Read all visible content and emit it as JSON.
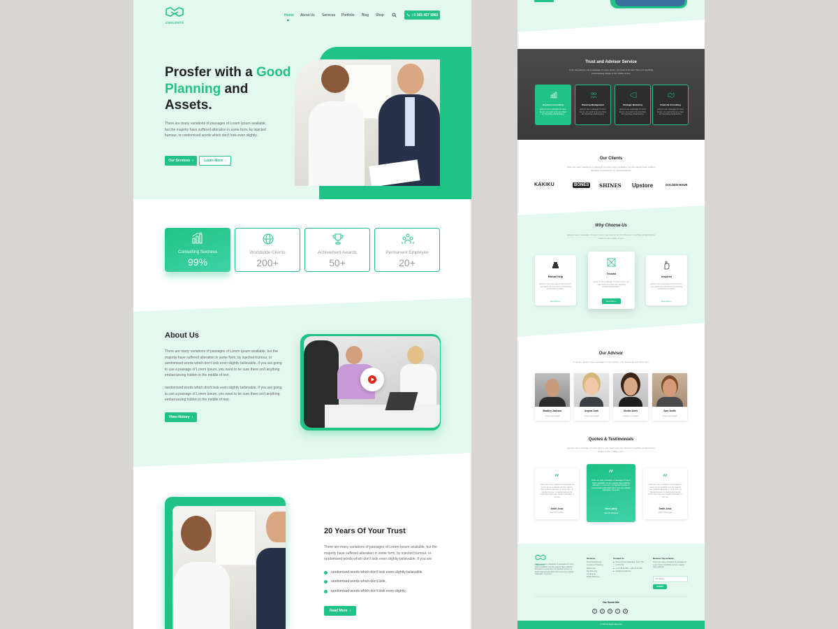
{
  "brand": {
    "name": "CNSLTNTS",
    "accent": "#21c288",
    "hero_bg": "#e3f8ef"
  },
  "nav": {
    "items": [
      "Home",
      "About Us",
      "Services",
      "Portfolio",
      "Blog",
      "Shop"
    ],
    "active": "Home",
    "phone": "+1 265 457 5963"
  },
  "hero": {
    "title_1": "Prosfer with a",
    "title_accent_1": "Good",
    "title_accent_2": "Planning",
    "title_2": "and",
    "title_3": "Assets.",
    "text": "There are many variations of passages of Lorem Ipsum available, but the majority have suffered alteration in some form, by injected humour, or randomised words which don't look even slightly.",
    "btn_services": "Our Services",
    "btn_learn": "Learn More"
  },
  "stats": [
    {
      "label": "Consulting Success",
      "value": "99%",
      "icon": "chart-icon",
      "active": true
    },
    {
      "label": "Worldwide Clients",
      "value": "200+",
      "icon": "globe-icon",
      "active": false
    },
    {
      "label": "Achivement Awards",
      "value": "50+",
      "icon": "trophy-icon",
      "active": false
    },
    {
      "label": "Permanent Employee",
      "value": "20+",
      "icon": "team-icon",
      "active": false
    }
  ],
  "about": {
    "title": "About Us",
    "p1": "There are many variations of passages of Lorem Ipsum available, but the majority have suffered alteration in some form, by injected humour, or randomised words which don't look even slightly believable. If you are going to use a passage of Lorem Ipsum, you need to be sure there isn't anything embarrassing hidden in the middle of text.",
    "p2": "randomised words which don't look even slightly believable. If you are going to use a passage of Lorem Ipsum, you need to be sure there isn't anything embarrassing hidden in the middle of text.",
    "btn": "View History"
  },
  "trust": {
    "title": "20 Years Of Your Trust",
    "text": "There are many variations of passages of Lorem Ipsum available, but the majority have suffered alteration in some form, by injected humour, or randomised words which don't look even slightly believable. If you are",
    "checks": [
      "randomised words which don't look even slightly believable.",
      "randomised words which don't look.",
      "randomised words which don't look even slightly."
    ],
    "btn": "Read More"
  },
  "service": {
    "title": "Trust and Advisor Service",
    "sub": "If you are going to use a passage of Lorem Ipsum, you need to be sure there isn't anything embarrassing hidden in the middle of text.",
    "cards": [
      {
        "title": "Business Consulting",
        "desc": "going to use a passage of Lorem Ipsum, you need to be sure there isn't anything embarrassing."
      },
      {
        "title": "Planning Management",
        "desc": "going to use a passage of Lorem Ipsum, you need to be sure there isn't anything embarrassing."
      },
      {
        "title": "Strategic Marketing",
        "desc": "going to use a passage of Lorem Ipsum, you need to be sure there isn't anything embarrassing."
      },
      {
        "title": "Financial Consulting",
        "desc": "going to use a passage of Lorem Ipsum, you need to be sure there isn't anything embarrassing."
      }
    ]
  },
  "clients": {
    "title": "Our Clients",
    "sub": "There are many variations of passages of Lorem Ipsum available, but the majority have suffered alteration in some form, by injected humour.",
    "logos": [
      "KAKIKU",
      "BONES",
      "SHINES",
      "Upstore",
      "GOLDEN HOUR"
    ]
  },
  "why": {
    "title": "Why Choose Us",
    "sub": "going to use a passage of Lorem Ipsum, you need to be sure there isn't anything embarrassing hidden in the middle of text.",
    "cards": [
      {
        "title": "Mutual Help",
        "desc": "going to use a passage of Lorem Ipsum, you need to be sure there isn't anything embarrassing hidden.",
        "btn": "Read More"
      },
      {
        "title": "Trusted",
        "desc": "going to use a passage of Lorem Ipsum, you need to be sure there isn't anything embarrassing hidden.",
        "btn": "Read More"
      },
      {
        "title": "Inspired",
        "desc": "going to use a passage of Lorem Ipsum, you need to be sure there isn't anything embarrassing hidden.",
        "btn": "Read More"
      }
    ]
  },
  "advisor": {
    "title": "Our Advisor",
    "sub": "If you are going to use a passage of Lorem Ipsum, you need to be sure there isn't.",
    "people": [
      {
        "name": "Bradley Jackson",
        "role": "Senior Consultant"
      },
      {
        "name": "Angela Jean",
        "role": "Senior Consultant"
      },
      {
        "name": "Shelbe Alms",
        "role": "Leading Consultant"
      },
      {
        "name": "Sam Smith",
        "role": "Senior Consultant"
      }
    ]
  },
  "quotes": {
    "title": "Quotes & Testimonials",
    "sub": "going to use a passage of Lorem Ipsum, you need to be sure there isn't anything embarrassing hidden in the middle of text.",
    "items": [
      {
        "text": "There are many variations of passages of Lorem Ipsum available, but the majority have suffered alteration in some form, by injected humour, or randomised words which don't look even slightly believable. If you are",
        "name": "Smith Jesst",
        "role": "CEO Of Templete"
      },
      {
        "text": "There are many variations of passages of Lorem Ipsum available, but the majority have suffered alteration in some form, by injected humour, or randomised words which don't look even slightly believable. If you are",
        "name": "Sara Lathly",
        "role": "CEO Of Templete"
      },
      {
        "text": "There are many variations of passages of Lorem Ipsum available, but the majority have suffered alteration in some form, by injected humour, or randomised words which don't look even slightly believable. If you are",
        "name": "Smith Jesst",
        "role": "CEO Of Templete"
      }
    ]
  },
  "footer": {
    "about": "There are many variations of passages of Lorem Ipsum available, but the majority have suffered alteration in some form, by injected humour, or randomised words which don't look even slightly believable. If you are",
    "services_title": "Services",
    "services": [
      "Financial Planning",
      "Investment Planning",
      "Retirement",
      "Tax Planning",
      "Life Events",
      "Estate Planning"
    ],
    "contact_title": "Contact Us",
    "address": "Street House Dabacaka, Town TR1 Ld Dhi PA",
    "phones": "+123 45 67 890 / +123 45 67 891",
    "email": "info@yourmail.com",
    "news_title": "Receive Tips & News",
    "news_text": "There are many variations of passages of Lorem Ipsum available, but the majority have suffered",
    "email_placeholder": "Your Email",
    "submit": "SUBMIT",
    "social_title": "Our Social Site",
    "copyright": "© 2020 All Rights Reserved"
  }
}
